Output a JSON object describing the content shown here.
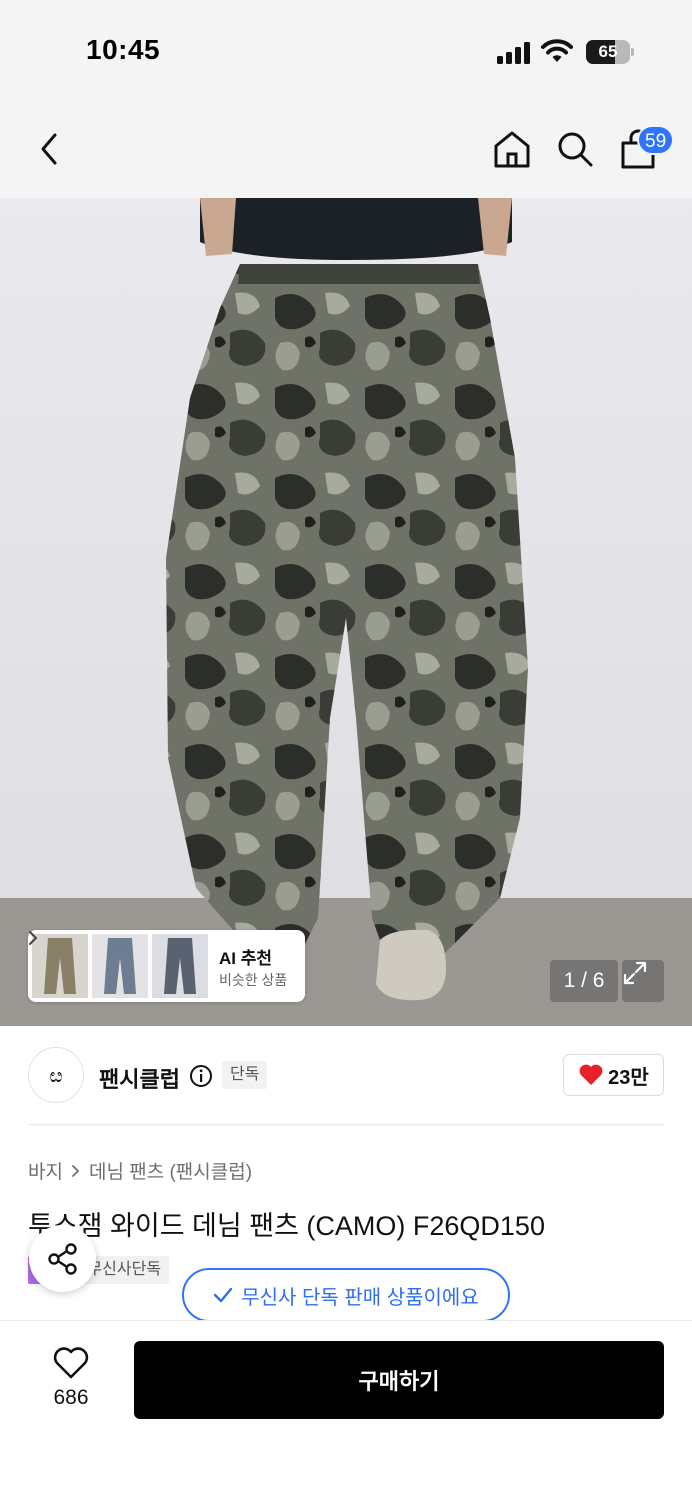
{
  "status_bar": {
    "time": "10:45",
    "battery_percent": "65",
    "battery_level": 0.65
  },
  "header": {
    "cart_count": "59"
  },
  "gallery": {
    "ai_card": {
      "title": "AI 추천",
      "subtitle": "비슷한 상품"
    },
    "page_counter": "1 / 6"
  },
  "brand": {
    "logo_text": "ೞ",
    "name": "팬시클럽",
    "exclusive_label": "단독",
    "like_count": "23만"
  },
  "product": {
    "breadcrumb": [
      "바지",
      "데님 팬츠 (팬시클럽)"
    ],
    "title": "투스잼 와이드 데님 팬츠 (CAMO) F26QD150",
    "tags": [
      "스타",
      "무신사단독"
    ]
  },
  "toast": {
    "text": "무신사 단독 판매 상품이에요"
  },
  "bottom_bar": {
    "wish_count": "686",
    "buy_label": "구매하기"
  },
  "colors": {
    "accent_blue": "#2f74ff",
    "tag_purple": "#b06ae8",
    "heart_red": "#e8202a",
    "buy_button": "#000000"
  }
}
